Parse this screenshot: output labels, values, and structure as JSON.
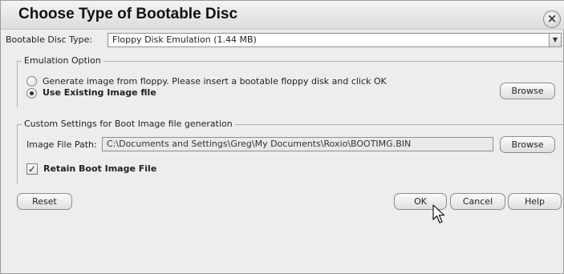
{
  "window": {
    "title": "Choose Type of Bootable Disc",
    "close_glyph": "×"
  },
  "disc_type": {
    "label": "Bootable Disc Type:",
    "value": "Floppy Disk Emulation (1.44 MB)",
    "arrow_glyph": "▼"
  },
  "emulation": {
    "legend": "Emulation Option",
    "option_floppy": "Generate image from floppy. Please insert a bootable floppy disk and click OK",
    "option_existing": "Use Existing Image file",
    "selected": "option_existing",
    "browse_label": "Browse"
  },
  "custom": {
    "legend": "Custom Settings for Boot Image file generation",
    "path_label": "Image File Path:",
    "path_value": "C:\\Documents and Settings\\Greg\\My Documents\\Roxio\\BOOTIMG.BIN",
    "browse_label": "Browse",
    "retain_label": "Retain Boot Image File",
    "retain_checked": true,
    "check_glyph": "✓"
  },
  "footer": {
    "reset_label": "Reset",
    "ok_label": "OK",
    "cancel_label": "Cancel",
    "help_label": "Help"
  },
  "icons": {
    "cursor": "mouse-pointer-icon"
  }
}
